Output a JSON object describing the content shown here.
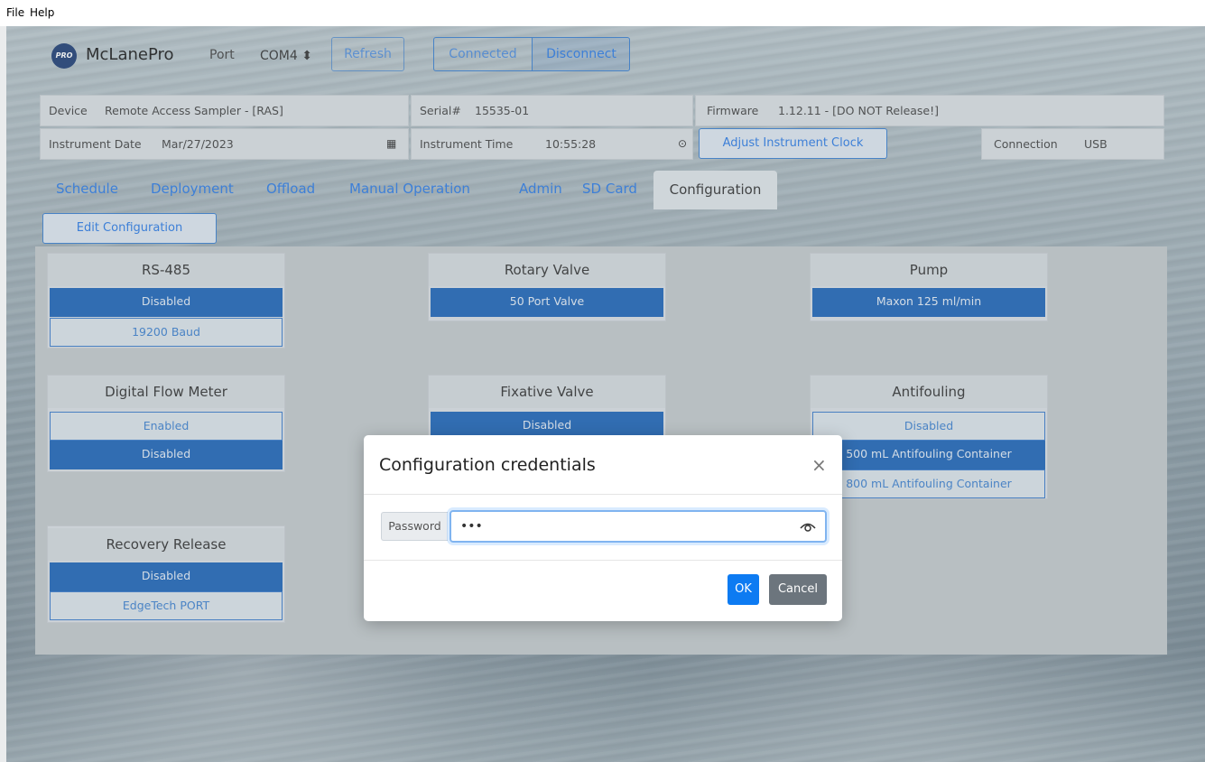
{
  "menu": {
    "file": "File",
    "help": "Help"
  },
  "header": {
    "logo_text": "PRO",
    "brand": "McLanePro",
    "port_label": "Port",
    "port_value": "COM4 ⬍",
    "refresh": "Refresh",
    "connected": "Connected",
    "disconnect": "Disconnect"
  },
  "info": {
    "device_label": "Device",
    "device_value": "Remote Access Sampler - [RAS]",
    "serial_label": "Serial#",
    "serial_value": "15535-01",
    "firmware_label": "Firmware",
    "firmware_value": "1.12.11 - [DO NOT Release!]",
    "date_label": "Instrument Date",
    "date_value": "Mar/27/2023",
    "time_label": "Instrument Time",
    "time_value": "10:55:28",
    "adjust_clock": "Adjust Instrument Clock",
    "connection_label": "Connection",
    "connection_value": "USB"
  },
  "tabs": [
    "Schedule",
    "Deployment",
    "Offload",
    "Manual Operation",
    "Admin",
    "SD Card",
    "Configuration"
  ],
  "active_tab": "Configuration",
  "edit_configuration": "Edit Configuration",
  "cards": {
    "rs485": {
      "title": "RS-485",
      "opt1": "Disabled",
      "opt2": "19200 Baud"
    },
    "rotary": {
      "title": "Rotary Valve",
      "opt1": "50 Port Valve"
    },
    "pump": {
      "title": "Pump",
      "opt1": "Maxon 125 ml/min"
    },
    "flow": {
      "title": "Digital Flow Meter",
      "opt1": "Enabled",
      "opt2": "Disabled"
    },
    "fixative": {
      "title": "Fixative Valve",
      "opt1": "Disabled"
    },
    "antifouling": {
      "title": "Antifouling",
      "opt1": "Disabled",
      "opt2": "500 mL Antifouling Container",
      "opt3": "800 mL Antifouling Container"
    },
    "recovery": {
      "title": "Recovery Release",
      "opt1": "Disabled",
      "opt2": "EdgeTech PORT"
    }
  },
  "modal": {
    "title": "Configuration credentials",
    "close": "×",
    "password_label": "Password",
    "password_value": "•••",
    "ok": "OK",
    "cancel": "Cancel"
  },
  "colors": {
    "accent": "#0d7bf2",
    "selected_option": "#1e64b8",
    "cancel": "#6c757d"
  }
}
